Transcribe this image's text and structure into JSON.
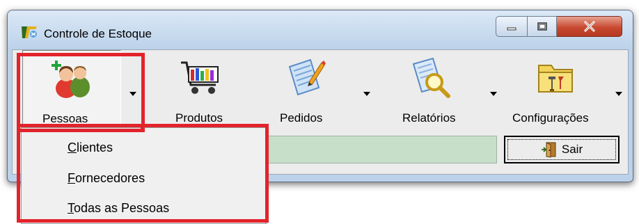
{
  "window": {
    "title": "Controle de Estoque",
    "controls": [
      "minimize",
      "maximize",
      "close"
    ]
  },
  "toolbar": {
    "items": [
      {
        "label": "Pessoas",
        "icon": "people-icon",
        "has_dropdown": true,
        "pressed": true
      },
      {
        "label": "Produtos",
        "icon": "shopping-cart-icon",
        "has_dropdown": false
      },
      {
        "label": "Pedidos",
        "icon": "edit-document-icon",
        "has_dropdown": true
      },
      {
        "label": "Relatórios",
        "icon": "search-document-icon",
        "has_dropdown": true
      },
      {
        "label": "Configurações",
        "icon": "tools-folder-icon",
        "has_dropdown": true
      }
    ]
  },
  "exit_button": {
    "label": "Sair",
    "icon": "door-exit-icon"
  },
  "dropdown_menu": {
    "items": [
      {
        "label": "Clientes",
        "mnemonic": "C"
      },
      {
        "label": "Fornecedores",
        "mnemonic": "F"
      },
      {
        "label": "Todas as Pessoas",
        "mnemonic": "T"
      }
    ]
  },
  "colors": {
    "highlight": "#e3232b",
    "status_strip": "#c7dfc8",
    "close_button": "#c94a32",
    "window_frame": "#bcd2ea"
  }
}
